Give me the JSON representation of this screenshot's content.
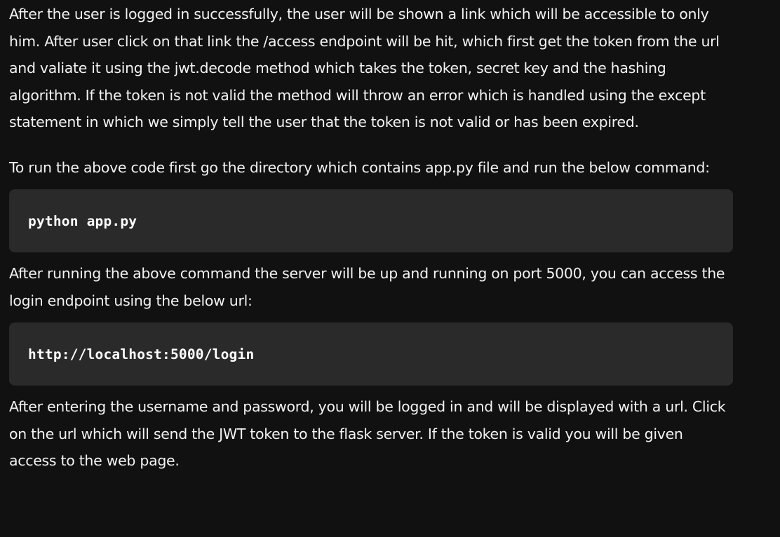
{
  "article": {
    "paragraph_1": "After the user is logged in successfully, the user will be shown a link which will be accessible to only him. After user click on that link the /access endpoint will be hit, which first get the token from the url and valiate it using the jwt.decode method which takes the token, secret key and the hashing algorithm. If the token is not valid the method will throw an error which is handled using the except statement in which we simply tell the user that the token is not valid or has been expired.",
    "paragraph_2": "To run the above code first go the directory which contains app.py file and run the below command:",
    "code_1": "python app.py",
    "paragraph_3": "After running the above command the server will be up and running on port 5000, you can access the login endpoint using the below url:",
    "code_2": "http://localhost:5000/login",
    "paragraph_4": "After entering the username and password, you will be logged in and will be displayed with a url. Click on the url which will send the JWT token to the flask server. If the token is valid you will be given access to the web page."
  },
  "colors": {
    "background": "#111111",
    "text": "#f2f2f2",
    "code_background": "#2a2a2a",
    "code_text": "#ffffff"
  }
}
